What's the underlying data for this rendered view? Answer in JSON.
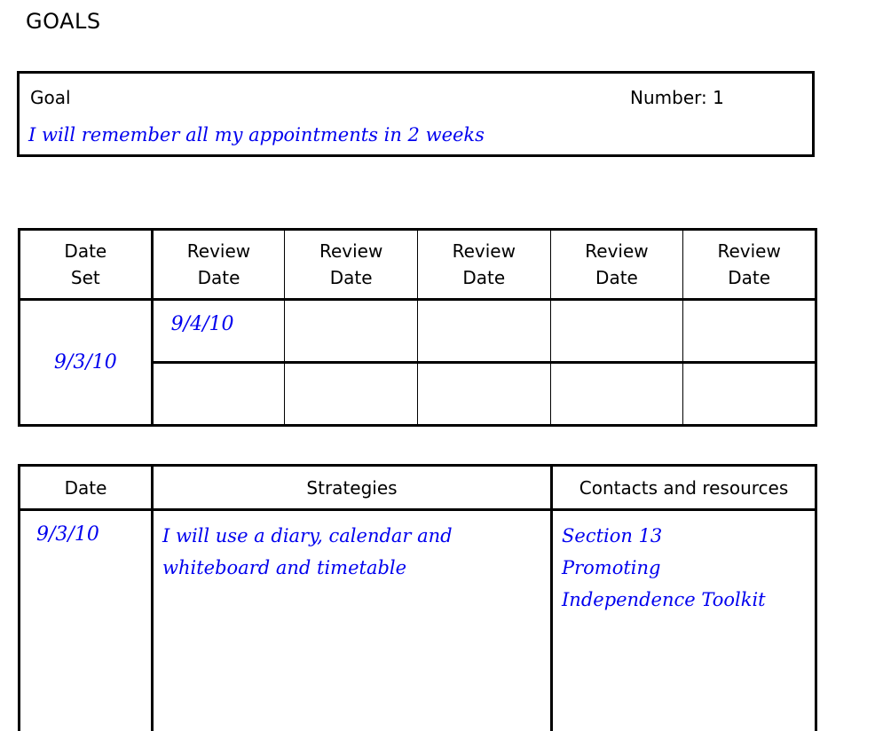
{
  "page_title": "GOALS",
  "goal": {
    "label": "Goal",
    "number_label": "Number: 1",
    "text": "I will remember all my appointments in 2 weeks"
  },
  "review_table": {
    "headers": [
      [
        "Date",
        "Set"
      ],
      [
        "Review",
        "Date"
      ],
      [
        "Review",
        "Date"
      ],
      [
        "Review",
        "Date"
      ],
      [
        "Review",
        "Date"
      ],
      [
        "Review",
        "Date"
      ]
    ],
    "date_set": "9/3/10",
    "review_dates_row1": [
      "9/4/10",
      "",
      "",
      "",
      ""
    ],
    "review_dates_row2": [
      "",
      "",
      "",
      "",
      ""
    ]
  },
  "strategies_table": {
    "headers": [
      "Date",
      "Strategies",
      "Contacts and resources"
    ],
    "rows": [
      {
        "date": "9/3/10",
        "strategy_lines": [
          "I will use a diary, calendar and",
          "whiteboard and timetable"
        ],
        "contacts_lines": [
          "Section 13",
          "Promoting",
          "Independence Toolkit"
        ]
      }
    ]
  }
}
